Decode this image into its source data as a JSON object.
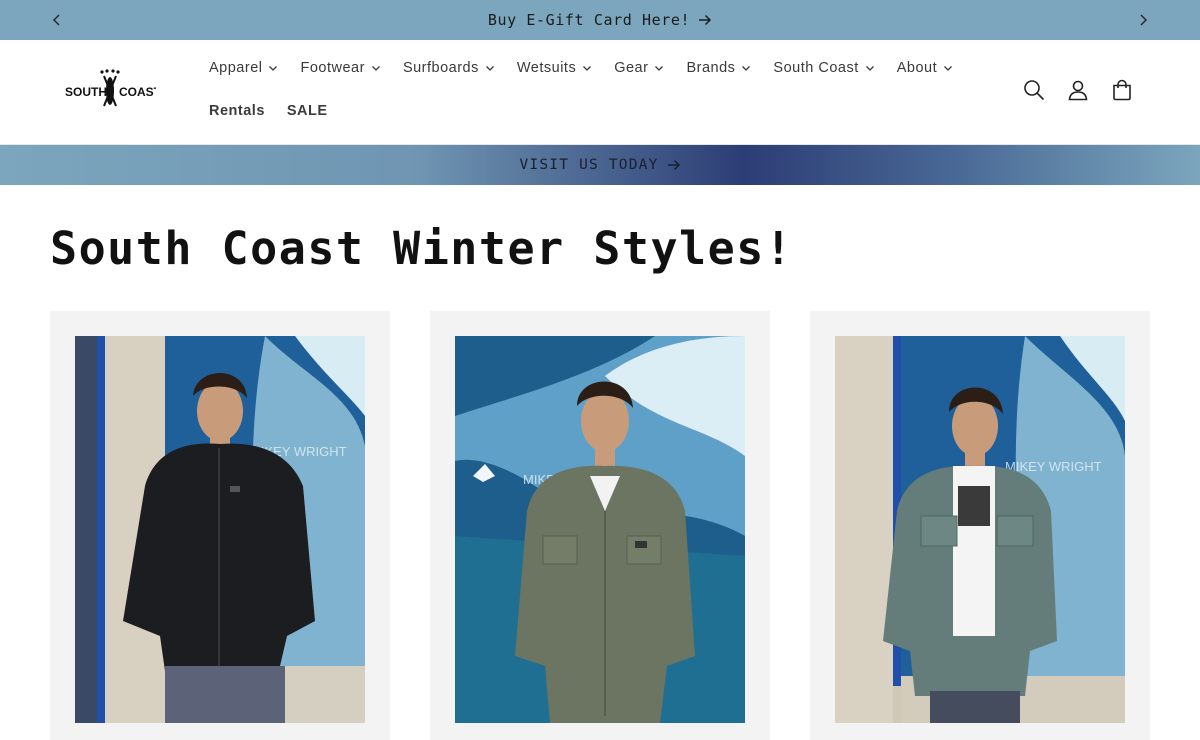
{
  "announcement": {
    "text": "Buy E-Gift Card Here!",
    "prev_icon": "chevron-left-icon",
    "next_icon": "chevron-right-icon",
    "background": "#7ba6bd"
  },
  "logo": {
    "text_left": "SOUTH",
    "text_right": "COAST",
    "icon": "surfboard-cross-logo"
  },
  "nav": {
    "row1": [
      {
        "label": "Apparel"
      },
      {
        "label": "Footwear"
      },
      {
        "label": "Surfboards"
      },
      {
        "label": "Wetsuits"
      },
      {
        "label": "Gear"
      },
      {
        "label": "Brands"
      },
      {
        "label": "South Coast"
      },
      {
        "label": "About"
      }
    ],
    "row2": [
      {
        "label": "Rentals"
      },
      {
        "label": "SALE"
      }
    ]
  },
  "header_icons": [
    "search-icon",
    "account-icon",
    "cart-icon"
  ],
  "banner": {
    "text": "VISIT US TODAY",
    "icon": "arrow-right-icon"
  },
  "page": {
    "title": "South Coast Winter Styles!"
  },
  "products": [
    {
      "jacket_color": "#1c1d21",
      "background_style": "doorway-left"
    },
    {
      "jacket_color": "#6b7561",
      "background_style": "full-wave"
    },
    {
      "jacket_color": "#647d7a",
      "background_style": "doorway-left"
    }
  ],
  "mural_text": "MIKEY WRIGHT",
  "colors": {
    "accent_blue": "#7ba6bd",
    "banner_dark": "#2c3d75",
    "card_bg": "#f3f3f3"
  }
}
